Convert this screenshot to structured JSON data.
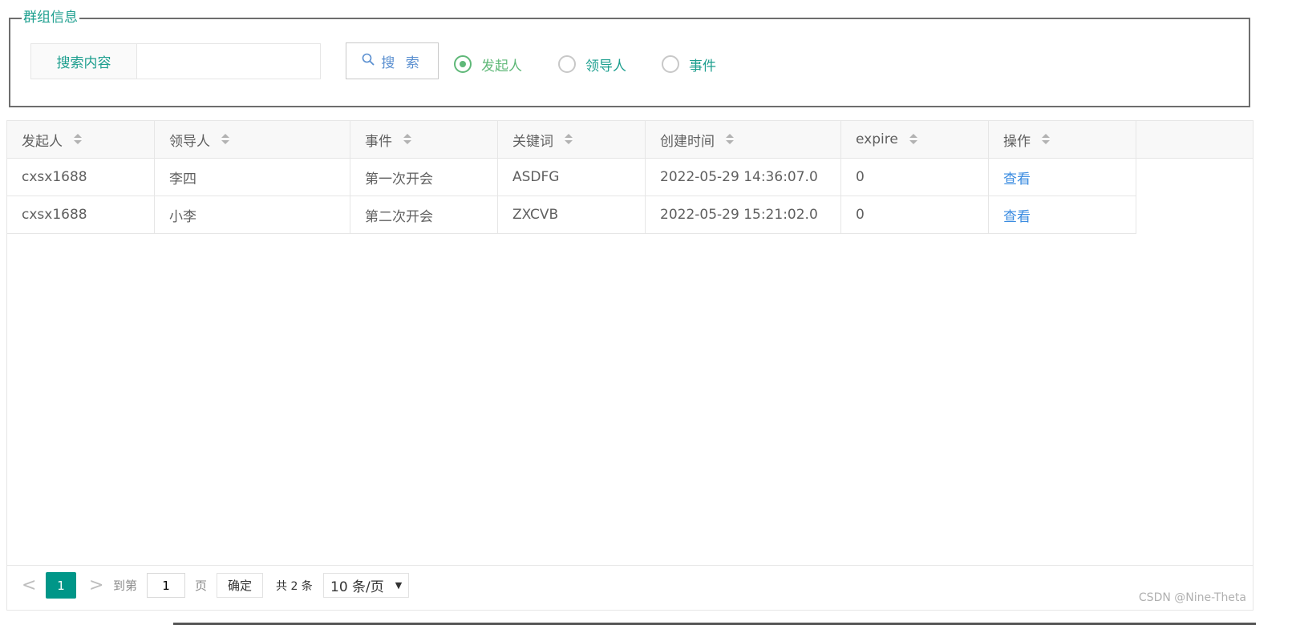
{
  "filter": {
    "legend": "群组信息",
    "search_label": "搜索内容",
    "search_value": "",
    "search_button": "搜 索",
    "radios": [
      {
        "label": "发起人",
        "checked": true
      },
      {
        "label": "领导人",
        "checked": false
      },
      {
        "label": "事件",
        "checked": false
      }
    ]
  },
  "table": {
    "columns": [
      "发起人",
      "领导人",
      "事件",
      "关键词",
      "创建时间",
      "expire",
      "操作"
    ],
    "rows": [
      {
        "initiator": "cxsx1688",
        "leader": "李四",
        "event": "第一次开会",
        "keyword": "ASDFG",
        "created": "2022-05-29 14:36:07.0",
        "expire": "0",
        "action": "查看"
      },
      {
        "initiator": "cxsx1688",
        "leader": "小李",
        "event": "第二次开会",
        "keyword": "ZXCVB",
        "created": "2022-05-29 15:21:02.0",
        "expire": "0",
        "action": "查看"
      }
    ]
  },
  "pager": {
    "prev": "<",
    "current": "1",
    "next": ">",
    "goto_prefix": "到第",
    "goto_value": "1",
    "goto_suffix": "页",
    "confirm": "确定",
    "total": "共 2 条",
    "page_size": "10 条/页"
  },
  "watermark": "CSDN @Nine-Theta"
}
